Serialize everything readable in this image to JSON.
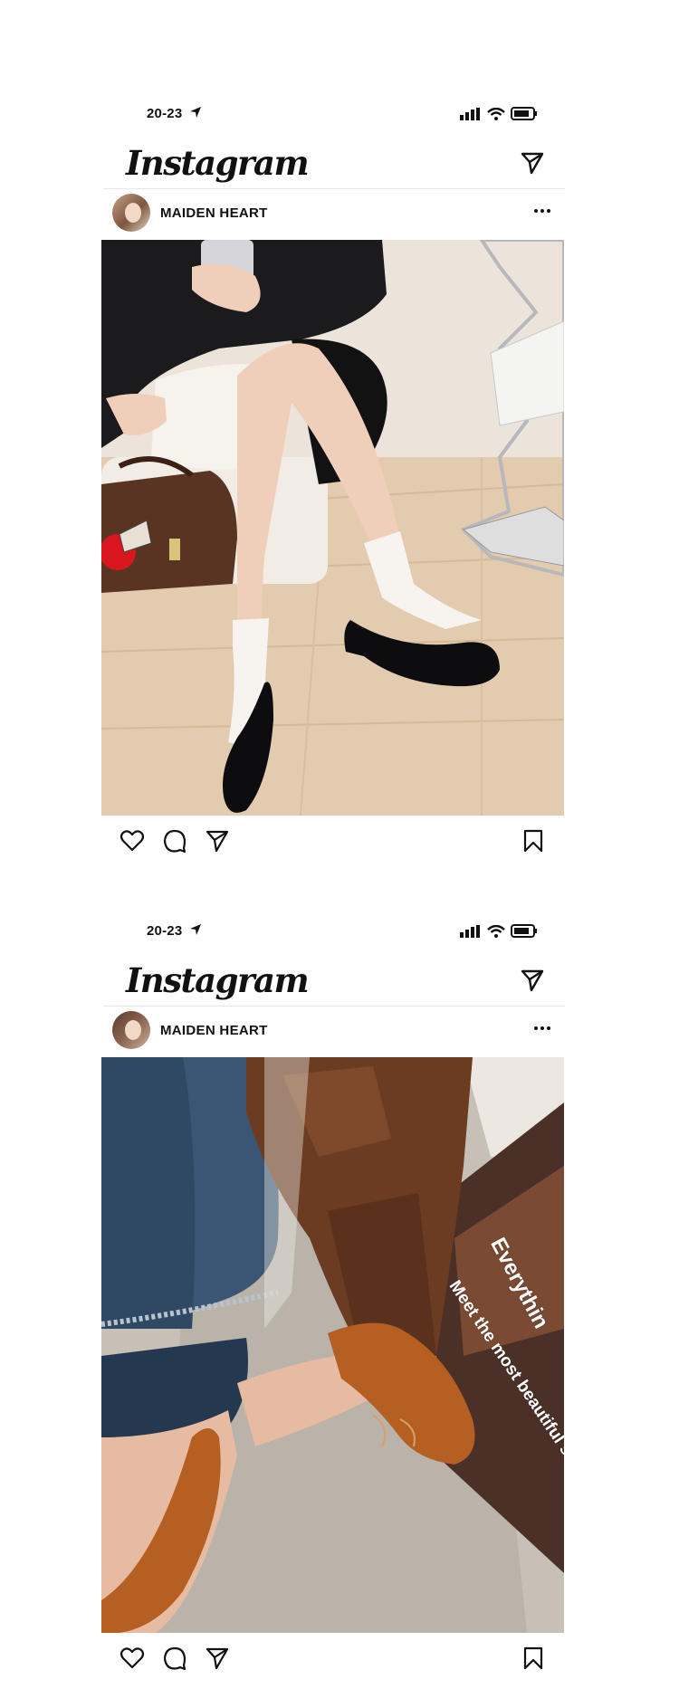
{
  "posts": [
    {
      "status_time": "20-23",
      "app_title": "Instagram",
      "username": "MAIDEN HEART"
    },
    {
      "status_time": "20-23",
      "app_title": "Instagram",
      "username": "MAIDEN HEART",
      "photo_overlay": {
        "headline": "Everythin",
        "subline": "Meet the most beautiful s"
      }
    }
  ],
  "icons": {
    "location": "location-arrow-icon",
    "signal": "signal-icon",
    "wifi": "wifi-icon",
    "battery": "battery-icon",
    "direct": "paper-plane-icon",
    "more": "more-dots-icon",
    "like": "heart-icon",
    "comment": "comment-icon",
    "share": "paper-plane-icon",
    "save": "bookmark-icon"
  }
}
